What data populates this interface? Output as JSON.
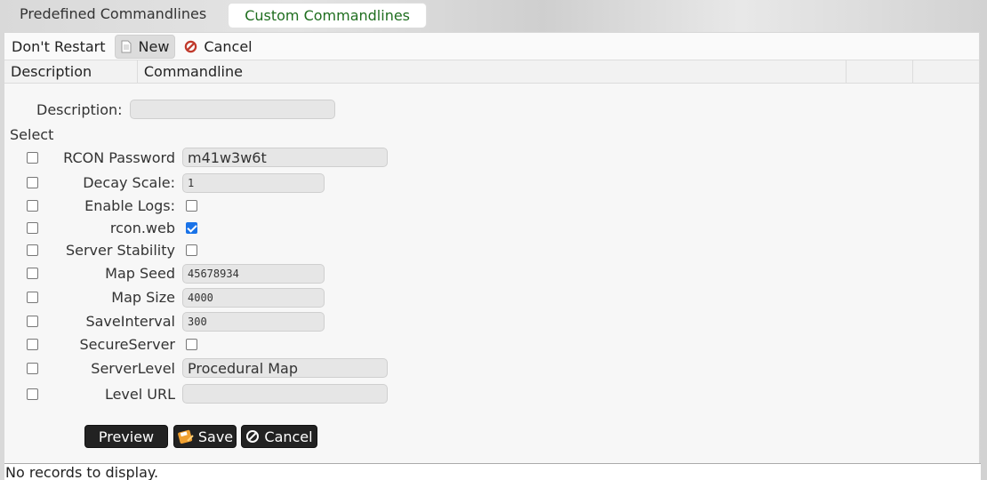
{
  "tabs": [
    {
      "label": "Predefined Commandlines"
    },
    {
      "label": "Custom Commandlines"
    }
  ],
  "toolbar": {
    "dont_restart": "Don't Restart",
    "new": "New",
    "cancel": "Cancel"
  },
  "grid": {
    "columns": [
      "Description",
      "Commandline",
      "",
      ""
    ]
  },
  "form": {
    "description_label": "Description:",
    "description_value": "",
    "select_label": "Select",
    "fields": [
      {
        "label": "RCON Password",
        "value": "m41w3w6t"
      },
      {
        "label": "Decay Scale:",
        "value": "1"
      },
      {
        "label": "Enable Logs:",
        "checked": false
      },
      {
        "label": "rcon.web",
        "checked": true
      },
      {
        "label": "Server Stability",
        "checked": false
      },
      {
        "label": "Map Seed",
        "value": "45678934"
      },
      {
        "label": "Map Size",
        "value": "4000"
      },
      {
        "label": "SaveInterval",
        "value": "300"
      },
      {
        "label": "SecureServer",
        "checked": false
      },
      {
        "label": "ServerLevel",
        "value": "Procedural Map"
      },
      {
        "label": "Level URL",
        "value": ""
      }
    ],
    "preview": "Preview",
    "save": "Save",
    "cancel": "Cancel"
  },
  "status": "No records to display.",
  "colors": {
    "active_tab_text": "#1f6e1f",
    "button_bg": "#222222",
    "check_accent": "#1a73e8"
  }
}
